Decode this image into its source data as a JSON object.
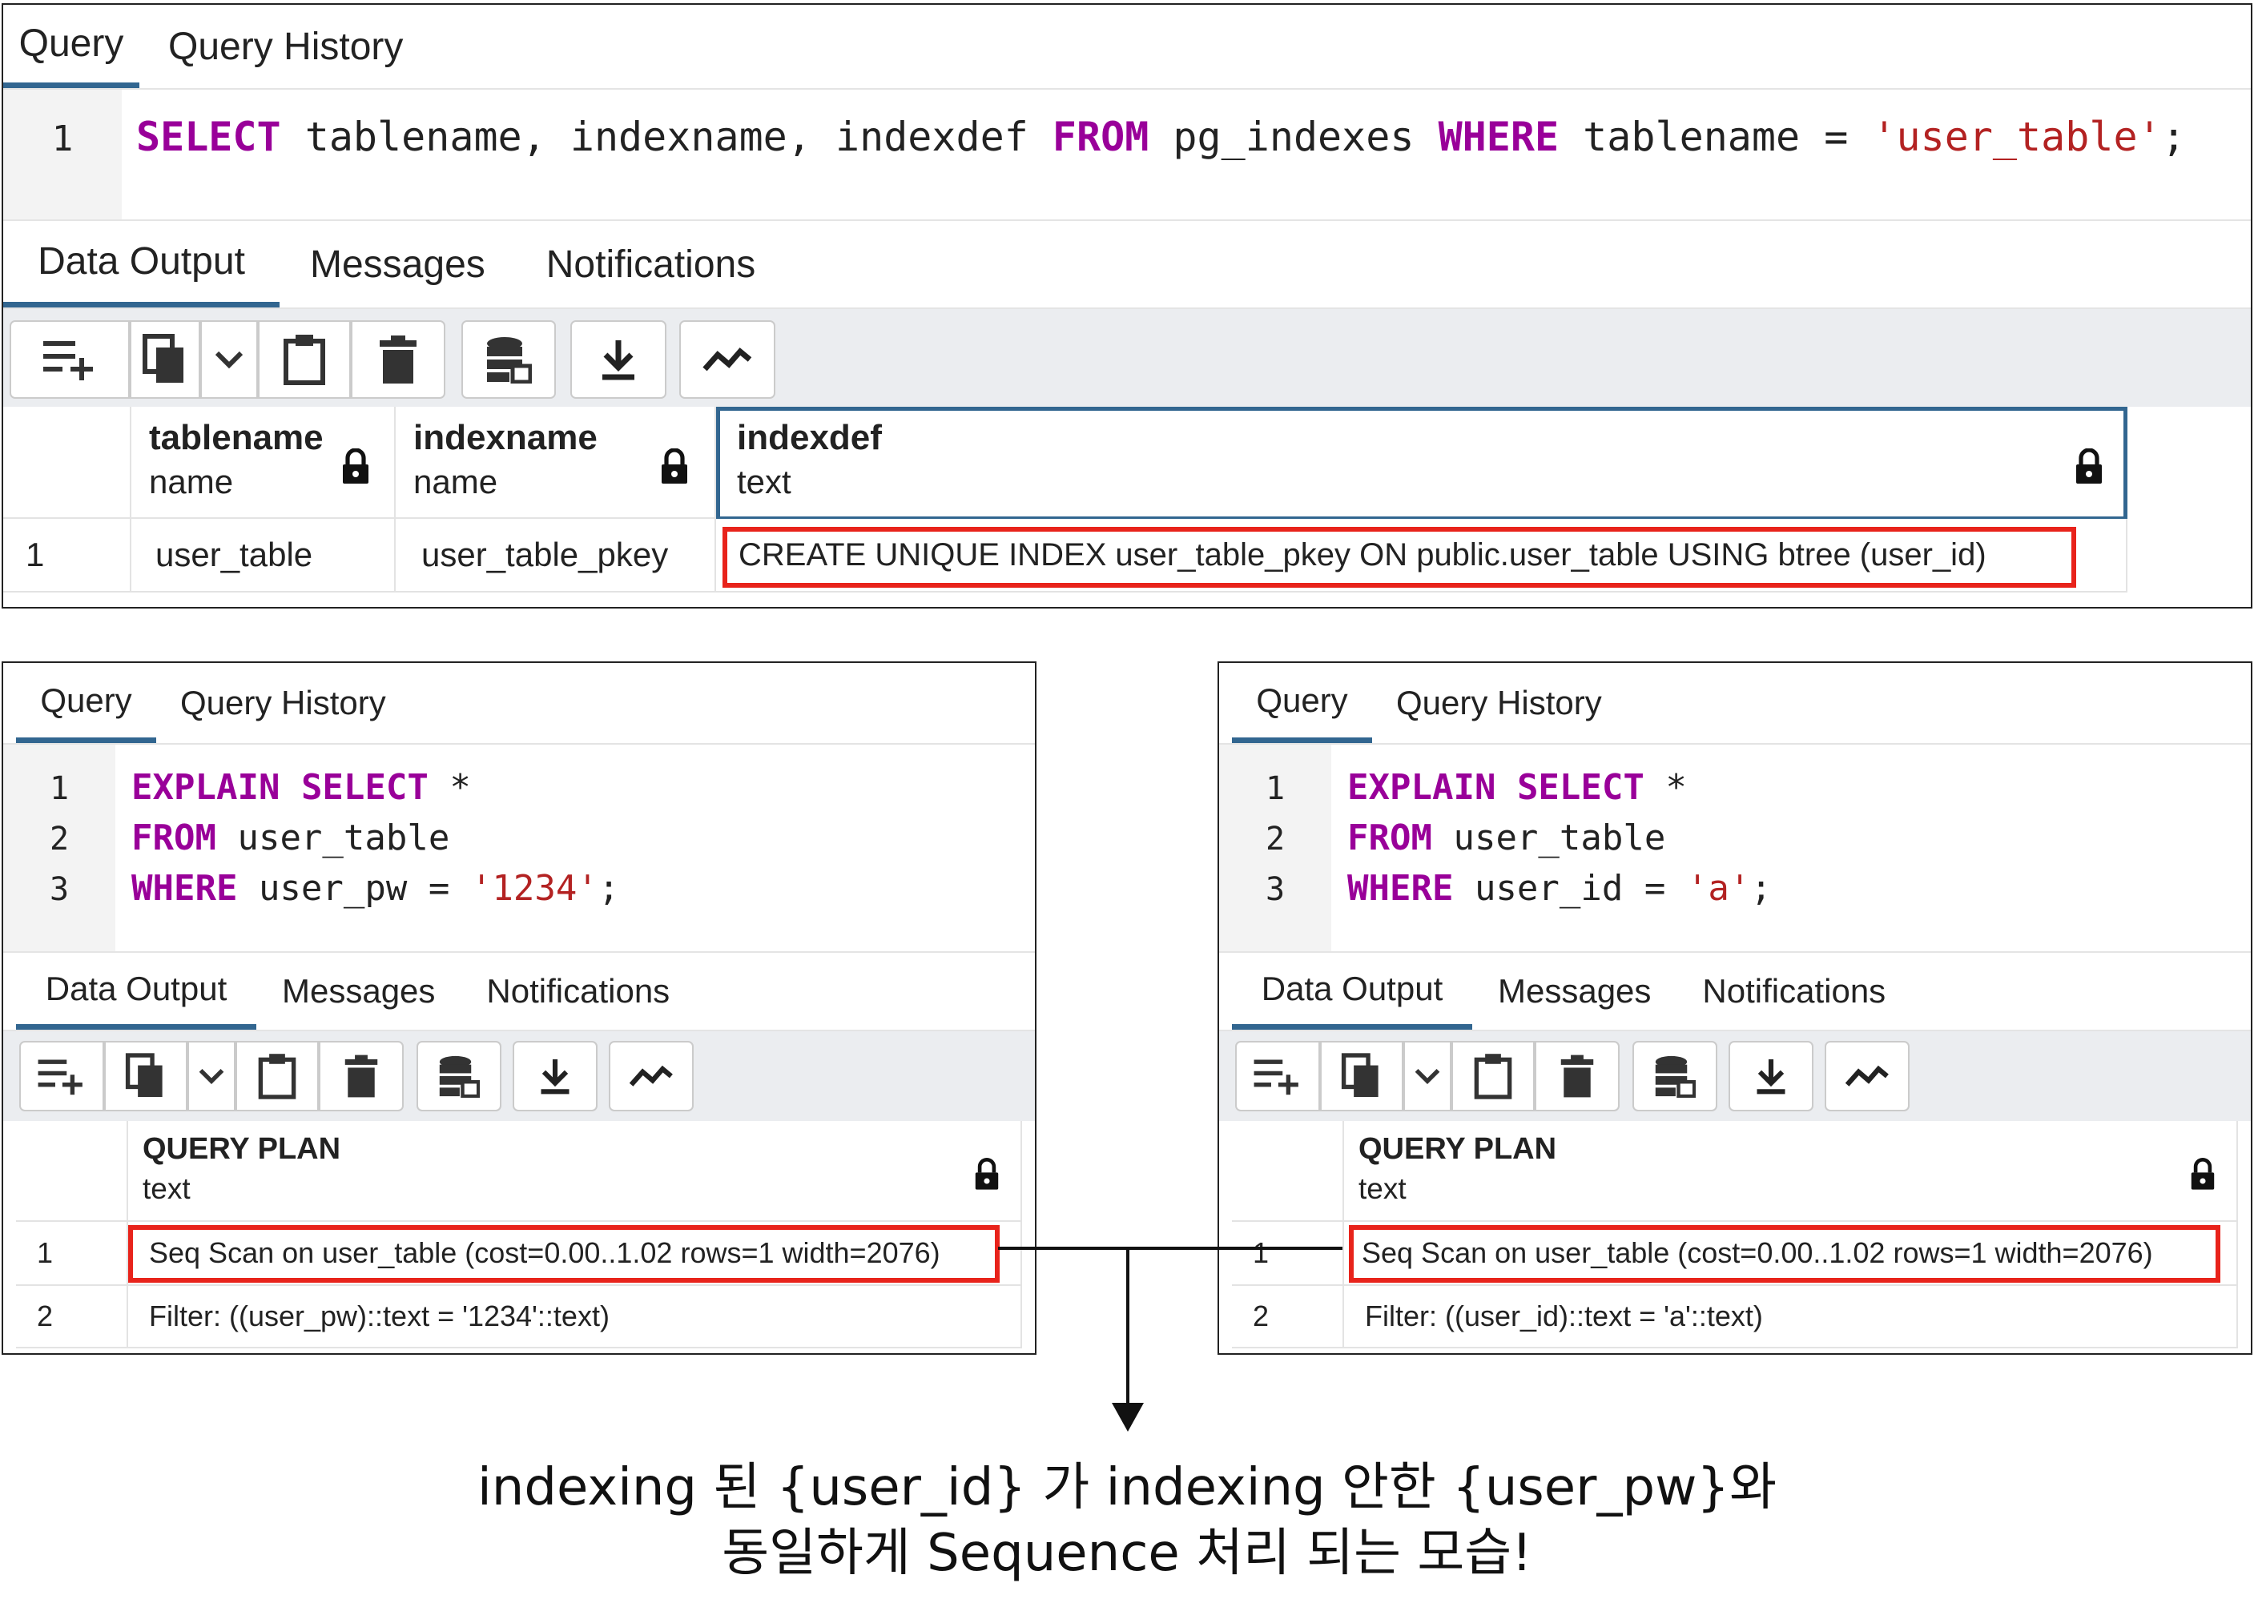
{
  "top": {
    "tabs": [
      "Query",
      "Query History"
    ],
    "line_numbers": [
      "1"
    ],
    "code": [
      [
        [
          "kw",
          "SELECT"
        ],
        [
          "plain",
          " tablename, indexname, indexdef "
        ],
        [
          "kw",
          "FROM"
        ],
        [
          "plain",
          " pg_indexes "
        ],
        [
          "kw",
          "WHERE"
        ],
        [
          "plain",
          " tablename = "
        ],
        [
          "str",
          "'user_table'"
        ],
        [
          "plain",
          ";"
        ]
      ]
    ],
    "result_tabs": [
      "Data Output",
      "Messages",
      "Notifications"
    ],
    "columns": [
      {
        "name": "tablename",
        "type": "name"
      },
      {
        "name": "indexname",
        "type": "name"
      },
      {
        "name": "indexdef",
        "type": "text"
      }
    ],
    "rows": [
      {
        "num": "1",
        "cells": [
          "user_table",
          "user_table_pkey",
          "CREATE UNIQUE INDEX user_table_pkey ON public.user_table USING btree (user_id)"
        ]
      }
    ]
  },
  "left": {
    "tabs": [
      "Query",
      "Query History"
    ],
    "line_numbers": [
      "1",
      "2",
      "3"
    ],
    "code": [
      [
        [
          "kw",
          "EXPLAIN"
        ],
        [
          "plain",
          " "
        ],
        [
          "kw",
          "SELECT"
        ],
        [
          "plain",
          " *"
        ]
      ],
      [
        [
          "kw",
          "FROM"
        ],
        [
          "plain",
          " user_table"
        ]
      ],
      [
        [
          "kw",
          "WHERE"
        ],
        [
          "plain",
          " user_pw = "
        ],
        [
          "str",
          "'1234'"
        ],
        [
          "plain",
          ";"
        ]
      ]
    ],
    "result_tabs": [
      "Data Output",
      "Messages",
      "Notifications"
    ],
    "column": {
      "name": "QUERY PLAN",
      "type": "text"
    },
    "rows": [
      {
        "num": "1",
        "text": "Seq Scan on user_table (cost=0.00..1.02 rows=1 width=2076)"
      },
      {
        "num": "2",
        "text": "Filter: ((user_pw)::text = '1234'::text)"
      }
    ]
  },
  "right": {
    "tabs": [
      "Query",
      "Query History"
    ],
    "line_numbers": [
      "1",
      "2",
      "3"
    ],
    "code": [
      [
        [
          "kw",
          "EXPLAIN"
        ],
        [
          "plain",
          " "
        ],
        [
          "kw",
          "SELECT"
        ],
        [
          "plain",
          " *"
        ]
      ],
      [
        [
          "kw",
          "FROM"
        ],
        [
          "plain",
          " user_table"
        ]
      ],
      [
        [
          "kw",
          "WHERE"
        ],
        [
          "plain",
          " user_id = "
        ],
        [
          "str",
          "'a'"
        ],
        [
          "plain",
          ";"
        ]
      ]
    ],
    "result_tabs": [
      "Data Output",
      "Messages",
      "Notifications"
    ],
    "column": {
      "name": "QUERY PLAN",
      "type": "text"
    },
    "rows": [
      {
        "num": "1",
        "text": "Seq Scan on user_table (cost=0.00..1.02 rows=1 width=2076)"
      },
      {
        "num": "2",
        "text": "Filter: ((user_id)::text = 'a'::text)"
      }
    ]
  },
  "toolbar_icons": [
    "add-row-icon",
    "copy-icon",
    "chevron-down-icon",
    "paste-icon",
    "delete-icon",
    "save-data-icon",
    "download-icon",
    "graph-icon"
  ],
  "caption": {
    "line1": "indexing 된 {user_id} 가 indexing 안한 {user_pw}와",
    "line2": "동일하게 Sequence 처리 되는 모습!"
  },
  "colors": {
    "accent": "#326690",
    "highlight": "#e8231b",
    "keyword": "#990099",
    "string": "#b32222"
  }
}
